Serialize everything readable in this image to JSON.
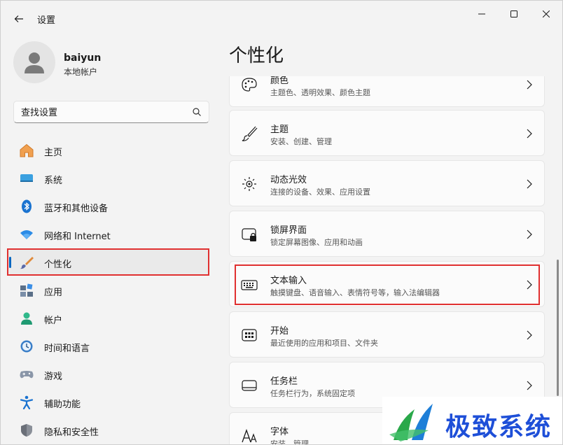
{
  "window": {
    "title": "设置",
    "controls": [
      "minimize",
      "maximize",
      "close"
    ]
  },
  "account": {
    "name": "baiyun",
    "type": "本地帐户"
  },
  "search": {
    "placeholder": "查找设置",
    "value": ""
  },
  "sidebar": {
    "items": [
      {
        "label": "主页",
        "icon": "home-icon",
        "active": false
      },
      {
        "label": "系统",
        "icon": "display-icon",
        "active": false
      },
      {
        "label": "蓝牙和其他设备",
        "icon": "bluetooth-icon",
        "active": false
      },
      {
        "label": "网络和 Internet",
        "icon": "wifi-icon",
        "active": false
      },
      {
        "label": "个性化",
        "icon": "brush-icon",
        "active": true
      },
      {
        "label": "应用",
        "icon": "apps-icon",
        "active": false
      },
      {
        "label": "帐户",
        "icon": "person-icon",
        "active": false
      },
      {
        "label": "时间和语言",
        "icon": "clock-globe-icon",
        "active": false
      },
      {
        "label": "游戏",
        "icon": "gamepad-icon",
        "active": false
      },
      {
        "label": "辅助功能",
        "icon": "accessibility-icon",
        "active": false
      },
      {
        "label": "隐私和安全性",
        "icon": "shield-icon",
        "active": false
      }
    ]
  },
  "main": {
    "title": "个性化",
    "cards": [
      {
        "title": "颜色",
        "subtitle": "主题色、透明效果、颜色主题",
        "icon": "palette-icon"
      },
      {
        "title": "主题",
        "subtitle": "安装、创建、管理",
        "icon": "brush-icon"
      },
      {
        "title": "动态光效",
        "subtitle": "连接的设备、效果、应用设置",
        "icon": "lighting-icon"
      },
      {
        "title": "锁屏界面",
        "subtitle": "锁定屏幕图像、应用和动画",
        "icon": "lock-screen-icon"
      },
      {
        "title": "文本输入",
        "subtitle": "触摸键盘、语音输入、表情符号等，输入法编辑器",
        "icon": "keyboard-icon",
        "highlighted": true
      },
      {
        "title": "开始",
        "subtitle": "最近使用的应用和项目、文件夹",
        "icon": "start-icon"
      },
      {
        "title": "任务栏",
        "subtitle": "任务栏行为，系统固定项",
        "icon": "taskbar-icon"
      },
      {
        "title": "字体",
        "subtitle": "安装、管理",
        "icon": "font-icon"
      }
    ]
  },
  "watermark": {
    "text": "极致系统"
  },
  "colors": {
    "accent": "#0067c0",
    "annotation": "#e03030",
    "watermark": "#1e4fd8"
  }
}
